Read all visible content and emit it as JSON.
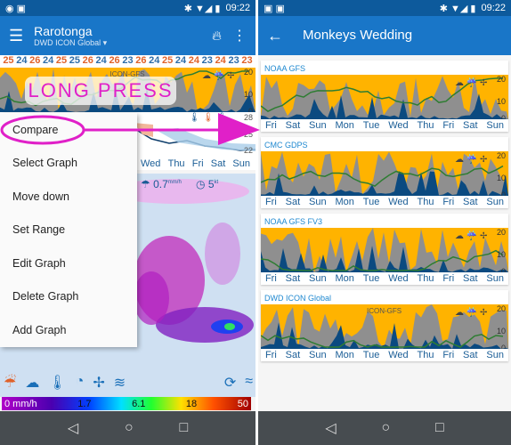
{
  "left": {
    "status": {
      "time": "09:22"
    },
    "title": "Rarotonga",
    "model": "DWD ICON Global",
    "temps": [
      "25",
      "24",
      "26",
      "24",
      "25",
      "25",
      "26",
      "24",
      "26",
      "23",
      "26",
      "24",
      "25",
      "24",
      "24",
      "23",
      "24",
      "23",
      "23"
    ],
    "chart_label": "ICON-GFS",
    "axis": [
      "20",
      "10",
      "0"
    ],
    "temp_axis": [
      "28",
      "25",
      "22"
    ],
    "days": [
      "Wed",
      "Thu",
      "Fri",
      "Sat",
      "Sun"
    ],
    "precip": "0.7",
    "precip_unit": "mm/h",
    "wind": "5",
    "wind_unit": "kt",
    "overlay": "LONG PRESS",
    "menu": [
      "Compare",
      "Select Graph",
      "Move down",
      "Set Range",
      "Edit Graph",
      "Delete Graph",
      "Add Graph"
    ],
    "scale": [
      "0 mm/h",
      "1.7",
      "6.1",
      "18",
      "50"
    ]
  },
  "right": {
    "status": {
      "time": "09:22"
    },
    "title": "Monkeys Wedding",
    "days": [
      "Fri",
      "Sat",
      "Sun",
      "Mon",
      "Tue",
      "Wed",
      "Thu",
      "Fri",
      "Sat",
      "Sun"
    ],
    "axis": [
      "20",
      "10",
      "0"
    ],
    "cards": [
      {
        "title": "NOAA GFS"
      },
      {
        "title": "CMC GDPS"
      },
      {
        "title": "NOAA GFS FV3"
      },
      {
        "title": "DWD ICON Global",
        "label": "ICON-GFS"
      }
    ]
  },
  "colors": {
    "accent": "#1976c8",
    "highlight": "#e020c8",
    "sun": "#ffb300",
    "cloud": "#8f8f8f",
    "rain": "#0b4a80",
    "line": "#2e7d32"
  }
}
